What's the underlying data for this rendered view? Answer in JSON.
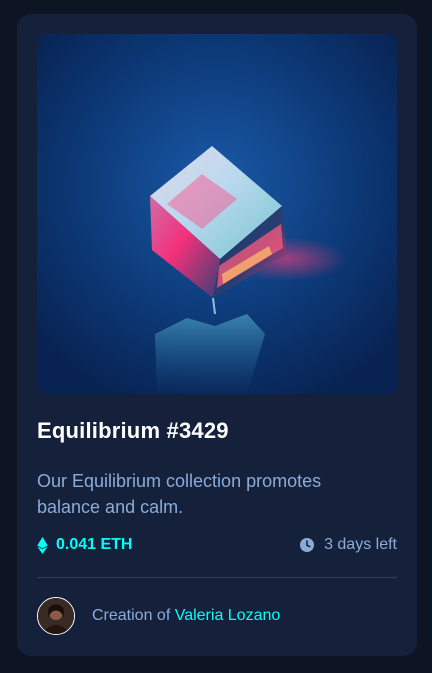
{
  "card": {
    "image": {
      "subject": "glowing translucent cube on blue background"
    },
    "title": "Equilibrium #3429",
    "description": "Our Equilibrium collection promotes balance and calm.",
    "price": {
      "icon": "ethereum-icon",
      "value": "0.041 ETH"
    },
    "time": {
      "icon": "clock-icon",
      "value": "3 days left"
    },
    "creator": {
      "prefix": "Creation of",
      "name": "Valeria Lozano"
    }
  },
  "colors": {
    "page_background": "#0d1423",
    "card_background": "#15203a",
    "accent_cyan": "#00fff8",
    "soft_blue_text": "#8bacd9",
    "white": "#ffffff",
    "divider": "#2e405a"
  }
}
